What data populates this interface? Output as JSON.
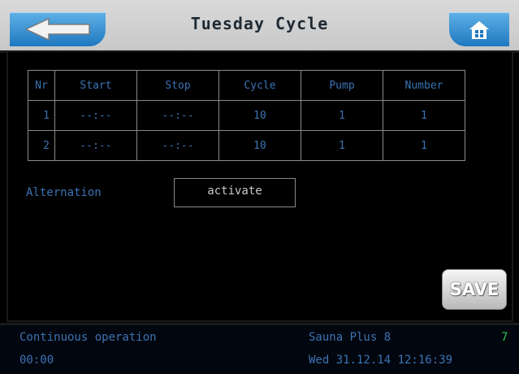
{
  "header": {
    "title": "Tuesday Cycle",
    "back_icon": "back-arrow-icon",
    "home_icon": "home-icon"
  },
  "table": {
    "headers": [
      "Nr",
      "Start",
      "Stop",
      "Cycle",
      "Pump",
      "Number"
    ],
    "rows": [
      [
        "1",
        "--:--",
        "--:--",
        "10",
        "1",
        "1"
      ],
      [
        "2",
        "--:--",
        "--:--",
        "10",
        "1",
        "1"
      ]
    ]
  },
  "alternation": {
    "label": "Alternation",
    "button": "activate"
  },
  "save_label": "SAVE",
  "footer": {
    "mode": "Continuous operation",
    "model": "Sauna Plus 8",
    "indicator": "7",
    "time": "00:00",
    "datetime": "Wed 31.12.14 12:16:39"
  },
  "colors": {
    "text_blue": "#3b73b4",
    "header_bg": "#d9d9d9",
    "button_blue": "#1f78c0",
    "indicator_green": "#2ec24a"
  }
}
